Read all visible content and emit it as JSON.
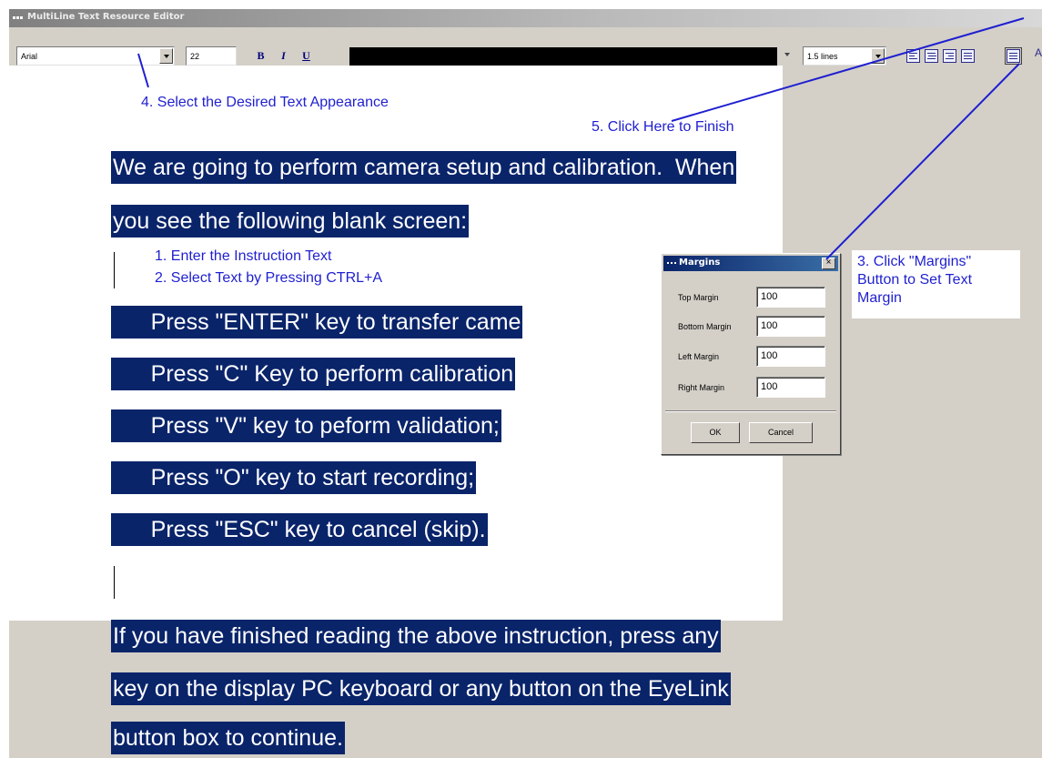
{
  "window": {
    "title": "MultiLine Text Resource Editor"
  },
  "toolbar": {
    "font_name": "Arial",
    "font_size": "22",
    "bold_label": "B",
    "italic_label": "I",
    "underline_label": "U",
    "text_color": "#000000",
    "line_spacing": "1.5 lines",
    "extra_glyph": "A"
  },
  "editor": {
    "lines": [
      "We are going to perform camera setup and calibration.  When",
      "you see the following blank screen:",
      "      Press \"ENTER\" key to transfer came",
      "      Press \"C\" Key to perform calibration",
      "      Press \"V\" key to peform validation;",
      "      Press \"O\" key to start recording;",
      "      Press \"ESC\" key to cancel (skip).",
      "If you have finished reading the above instruction, press any",
      "key on the display PC keyboard or any button on the EyeLink",
      "button box to continue."
    ],
    "selection_color": "#0a246a"
  },
  "annotations": {
    "step1": "1. Enter the Instruction Text",
    "step2": "2. Select Text by Pressing CTRL+A",
    "step3": "3. Click \"Margins\"\nButton to Set Text\nMargin",
    "step4": "4. Select the Desired Text Appearance",
    "step5": "5. Click Here to Finish",
    "color": "#1f1fd0"
  },
  "margins_dialog": {
    "title": "Margins",
    "close_glyph": "×",
    "top_label": "Top Margin",
    "top_value": "100",
    "bottom_label": "Bottom Margin",
    "bottom_value": "100",
    "left_label": "Left Margin",
    "left_value": "100",
    "right_label": "Right Margin",
    "right_value": "100",
    "ok_label": "OK",
    "cancel_label": "Cancel"
  }
}
